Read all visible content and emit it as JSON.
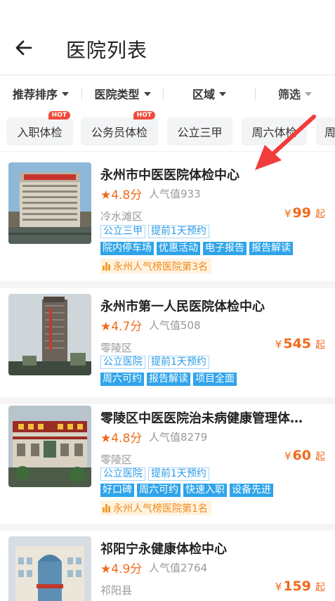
{
  "header": {
    "title": "医院列表",
    "back_icon": "back-arrow-icon"
  },
  "filters": [
    {
      "label": "推荐排序"
    },
    {
      "label": "医院类型"
    },
    {
      "label": "区域"
    },
    {
      "label": "筛选"
    }
  ],
  "tags": [
    {
      "label": "入职体检",
      "hot": "HOT"
    },
    {
      "label": "公务员体检",
      "hot": "HOT"
    },
    {
      "label": "公立三甲"
    },
    {
      "label": "周六体检"
    },
    {
      "label": "周"
    }
  ],
  "hospitals": [
    {
      "name": "永州市中医医院体检中心",
      "rating": "★4.8分",
      "popularity": "人气值933",
      "district": "冷水滩区",
      "price_symbol": "¥",
      "price": "99",
      "price_suffix": "起",
      "chips_row1": [
        "公立三甲",
        "提前1天预约"
      ],
      "chips_row2": [
        "院内停车场",
        "优惠活动",
        "电子报告",
        "报告解读"
      ],
      "rank": "永州人气榜医院第3名"
    },
    {
      "name": "永州市第一人民医院体检中心",
      "rating": "★4.7分",
      "popularity": "人气值508",
      "district": "零陵区",
      "price_symbol": "¥",
      "price": "545",
      "price_suffix": "起",
      "chips_row1": [
        "公立医院",
        "提前1天预约"
      ],
      "chips_row2": [
        "周六可约",
        "报告解读",
        "项目全面"
      ]
    },
    {
      "name": "零陵区中医医院治未病健康管理体…",
      "rating": "★4.8分",
      "popularity": "人气值8279",
      "district": "零陵区",
      "price_symbol": "¥",
      "price": "60",
      "price_suffix": "起",
      "chips_row1": [
        "公立医院",
        "提前1天预约"
      ],
      "chips_row2": [
        "好口碑",
        "周六可约",
        "快速入职",
        "设备先进"
      ],
      "rank": "永州人气榜医院第1名"
    },
    {
      "name": "祁阳宁永健康体检中心",
      "rating": "★4.9分",
      "popularity": "人气值2764",
      "district": "祁阳县",
      "price_symbol": "¥",
      "price": "159",
      "price_suffix": "起"
    }
  ],
  "colors": {
    "accent": "#f06a1c",
    "chip_blue": "#2fa4ea",
    "annotation": "#f23c3c"
  }
}
